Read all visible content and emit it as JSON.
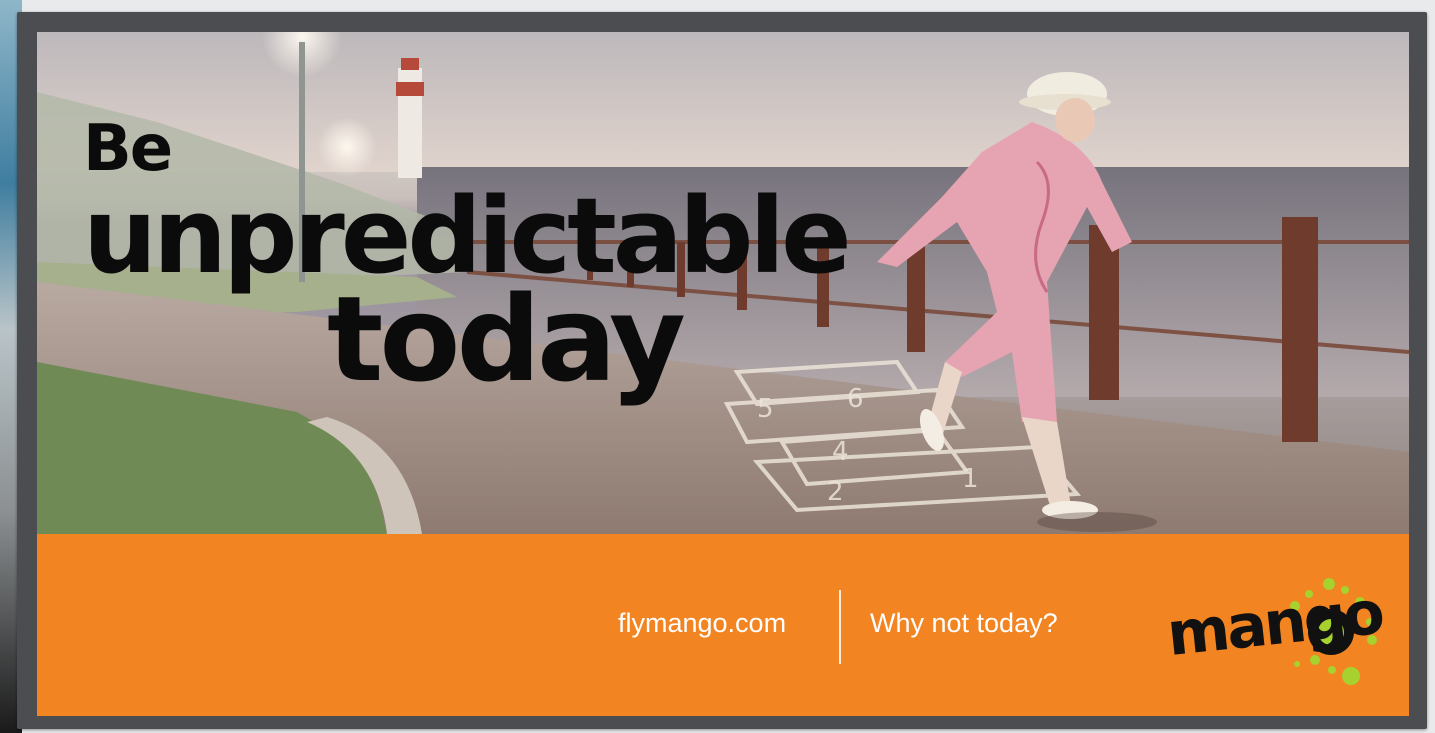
{
  "headline": {
    "line1": "Be",
    "line2": "unpredictable",
    "line3": "today"
  },
  "footer": {
    "website": "flymango.com",
    "tagline": "Why not today?",
    "logo_text": "mango"
  },
  "hopscotch_numbers": [
    "5",
    "6",
    "4",
    "2",
    "1"
  ],
  "colors": {
    "banner": "#f28422",
    "frame": "#4b4d50",
    "headline": "#0b0b0b",
    "logo_dots": "#a6d12e"
  }
}
